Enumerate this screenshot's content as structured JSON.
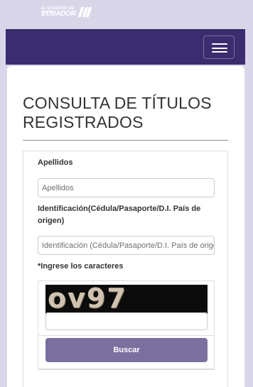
{
  "brand": {
    "logo_small": "EL GOBIERNO DE TODOS",
    "logo_text": "ECUADOR",
    "logo_icon": "ecuador-stripes-logo"
  },
  "navbar": {
    "menu_icon": "hamburger-menu-icon",
    "background_color": "#3a2c6e"
  },
  "page": {
    "title": "CONSULTA DE TÍTULOS REGISTRADOS"
  },
  "form": {
    "apellidos": {
      "label": "Apellidos",
      "placeholder": "Apellidos",
      "value": ""
    },
    "identificacion": {
      "label": "Identificación(Cédula/Pasaporte/D.I. País de origen)",
      "placeholder": "Identificación (Cédula/Pasaporte/D.I. País de origen)",
      "value": ""
    },
    "captcha": {
      "label": "*Ingrese los caracteres",
      "image_text": "ov97",
      "value": ""
    },
    "submit_label": "Buscar",
    "button_color": "#7b6f9f"
  }
}
